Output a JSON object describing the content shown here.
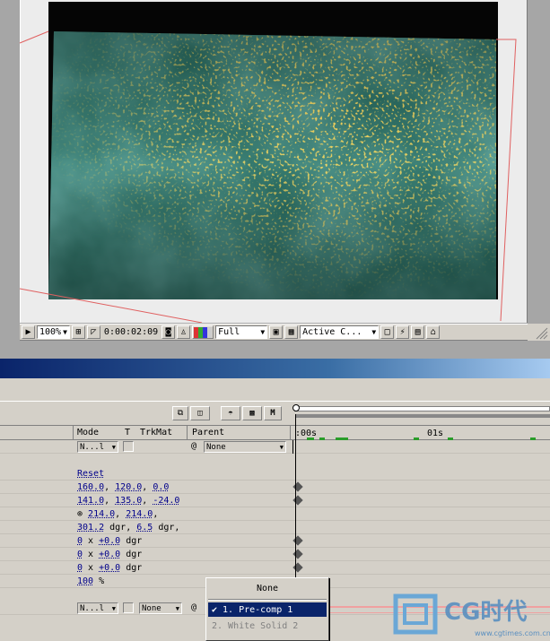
{
  "composition_viewer": {
    "toolbar": {
      "zoom": "100%",
      "timecode": "0:00:02:09",
      "resolution": "Full",
      "view": "Active C...",
      "icons": [
        "preview-icon",
        "safe-zones-icon",
        "mask-icon",
        "snapshot-icon",
        "show-snapshot-icon",
        "color-channels-icon",
        "roi-icon",
        "transparency-grid-icon",
        "fast-preview-icon",
        "flowchart-icon",
        "comp-flowchart-icon"
      ]
    }
  },
  "timeline": {
    "switch_icons": [
      "draft-3d-icon",
      "frame-blending-icon",
      "motion-blur-icon",
      "brainstorm-icon",
      "graph-editor-icon"
    ],
    "switch_m_label": "M",
    "columns": {
      "mode": "Mode",
      "t": "T",
      "trkmat": "TrkMat",
      "parent": "Parent"
    },
    "ruler": {
      "start_label": ":00s",
      "mid_label": "01s"
    },
    "layer1": {
      "mode": "N...l",
      "parent": "None"
    },
    "properties": [
      {
        "parts": [
          "Reset"
        ],
        "keyframe": false
      },
      {
        "parts": [
          "160.0",
          ", ",
          "120.0",
          ", ",
          "0.0"
        ],
        "keyframe": true
      },
      {
        "parts": [
          "141.0",
          ", ",
          "135.0",
          ", ",
          "-24.0"
        ],
        "keyframe": true
      },
      {
        "parts": [
          "214.0",
          ", ",
          "214.0",
          ","
        ],
        "keyframe": false,
        "link_icon": true
      },
      {
        "parts": [
          "301.2",
          " dgr, ",
          "6.5",
          " dgr,"
        ],
        "keyframe": false
      },
      {
        "parts": [
          "0",
          " x ",
          "+0.0",
          " dgr"
        ],
        "keyframe": true
      },
      {
        "parts": [
          "0",
          " x ",
          "+0.0",
          " dgr"
        ],
        "keyframe": true
      },
      {
        "parts": [
          "0",
          " x ",
          "+0.0",
          " dgr"
        ],
        "keyframe": true
      },
      {
        "parts": [
          "100",
          " %"
        ],
        "keyframe": false
      }
    ],
    "layer2": {
      "mode": "N...l",
      "trkmat": "None"
    }
  },
  "parent_popup": {
    "items": [
      "None",
      "✔ 1. Pre-comp 1",
      "2. White Solid 2"
    ],
    "selected_index": 1
  },
  "watermark": {
    "logo_text": "CG时代",
    "url": "www.cgtimes.com.cn"
  },
  "colors": {
    "selection": "#0a246a",
    "keyframe": "#555555",
    "work_area": "#2a9d2a",
    "layer_bar": "#f0a0a0"
  }
}
